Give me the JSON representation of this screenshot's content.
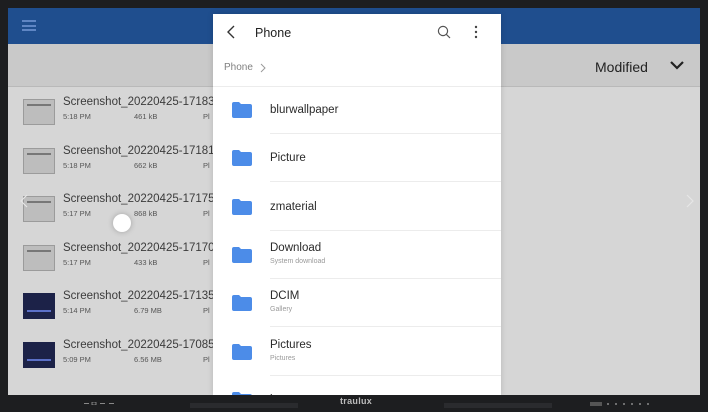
{
  "background_app": {
    "sort_label": "Modified",
    "files": [
      {
        "name": "Screenshot_20220425-17183",
        "time": "5:18 PM",
        "size": "461 kB",
        "prefix": "Pl",
        "thumb": "light"
      },
      {
        "name": "Screenshot_20220425-17181",
        "time": "5:18 PM",
        "size": "662 kB",
        "prefix": "Pl",
        "thumb": "light"
      },
      {
        "name": "Screenshot_20220425-17175",
        "time": "5:17 PM",
        "size": "868 kB",
        "prefix": "Pl",
        "thumb": "light"
      },
      {
        "name": "Screenshot_20220425-17170",
        "time": "5:17 PM",
        "size": "433 kB",
        "prefix": "Pl",
        "thumb": "light"
      },
      {
        "name": "Screenshot_20220425-17135",
        "time": "5:14 PM",
        "size": "6.79 MB",
        "prefix": "Pl",
        "thumb": "dark"
      },
      {
        "name": "Screenshot_20220425-17085",
        "time": "5:09 PM",
        "size": "6.56 MB",
        "prefix": "Pl",
        "thumb": "dark"
      }
    ]
  },
  "picker": {
    "title": "Phone",
    "breadcrumb": "Phone",
    "folders": [
      {
        "name": "blurwallpaper",
        "subtitle": ""
      },
      {
        "name": "Picture",
        "subtitle": ""
      },
      {
        "name": "zmaterial",
        "subtitle": ""
      },
      {
        "name": "Download",
        "subtitle": "System download"
      },
      {
        "name": "DCIM",
        "subtitle": "Gallery"
      },
      {
        "name": "Pictures",
        "subtitle": "Pictures"
      },
      {
        "name": "log",
        "subtitle": ""
      }
    ]
  },
  "device": {
    "brand": "traulux"
  },
  "colors": {
    "appbar": "#1f4e8e",
    "folder": "#4c8ce8",
    "screen_dim": "#d6d6d6"
  },
  "icons": [
    "menu-icon",
    "chevron-down-icon",
    "back-icon",
    "search-icon",
    "more-vertical-icon",
    "chevron-right-icon",
    "folder-icon"
  ]
}
